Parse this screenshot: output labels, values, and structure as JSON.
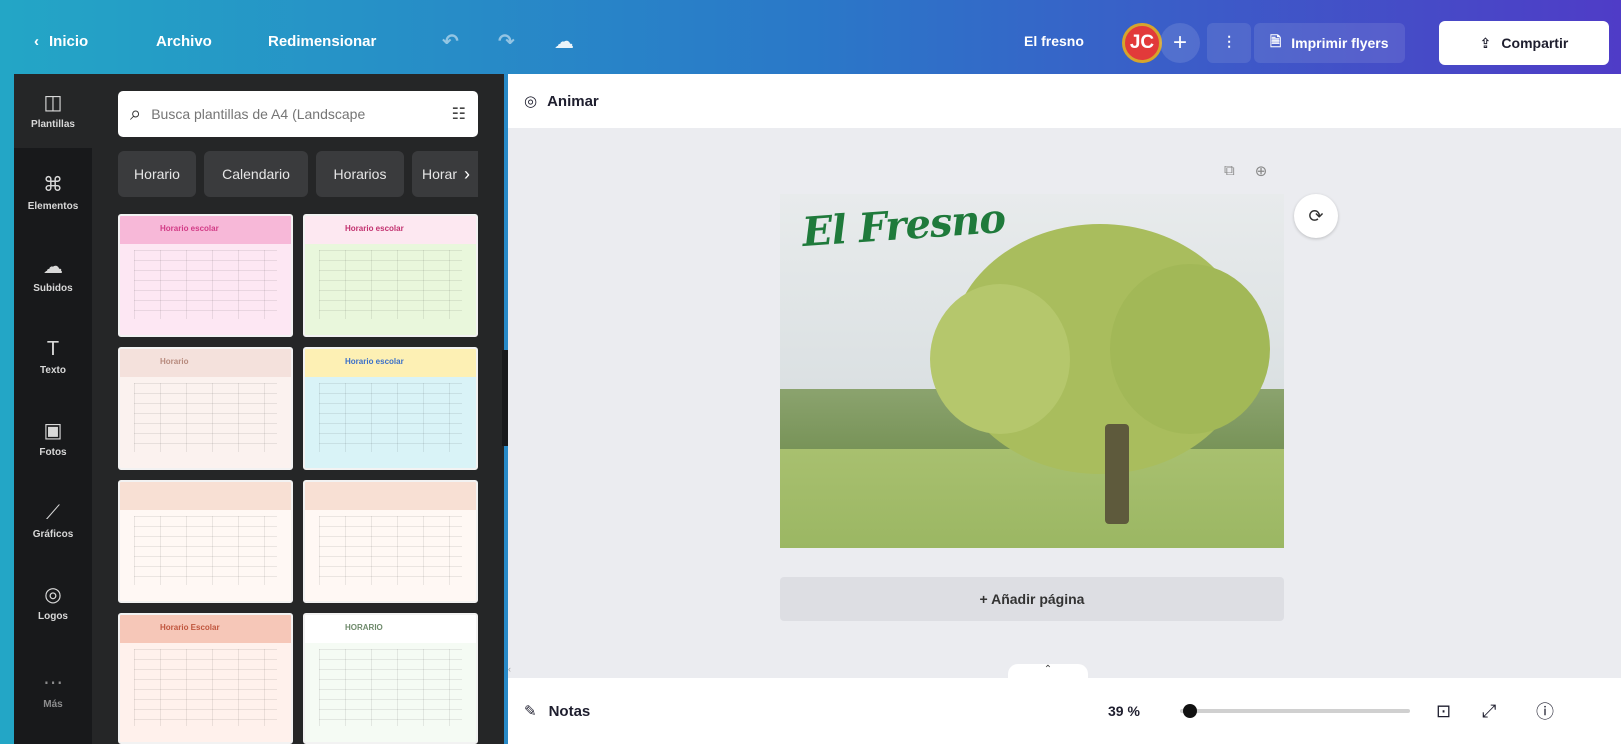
{
  "topbar": {
    "home_label": "Inicio",
    "file_label": "Archivo",
    "resize_label": "Redimensionar",
    "doc_name": "El fresno",
    "avatar_initials": "JC",
    "print_label": "Imprimir flyers",
    "share_label": "Compartir"
  },
  "icons": {
    "back": "‹",
    "undo": "↶",
    "redo": "↷",
    "cloud": "☁",
    "plus": "+",
    "chart": "⫶",
    "print": "🗎",
    "share": "⇪"
  },
  "rail": {
    "items": [
      {
        "label": "Plantillas",
        "icon": "◫"
      },
      {
        "label": "Elementos",
        "icon": "⌘"
      },
      {
        "label": "Subidos",
        "icon": "☁"
      },
      {
        "label": "Texto",
        "icon": "T"
      },
      {
        "label": "Fotos",
        "icon": "▣"
      },
      {
        "label": "Gráficos",
        "icon": "⟋"
      },
      {
        "label": "Logos",
        "icon": "◎"
      },
      {
        "label": "Más",
        "icon": "⋯"
      }
    ]
  },
  "panel": {
    "search_placeholder": "Busca plantillas de A4 (Landscape",
    "chips": [
      "Horario",
      "Calendario",
      "Horarios",
      "Horar"
    ],
    "templates": [
      {
        "title": "Horario escolar",
        "bg": "#fde7f3",
        "header": "#f7b8d8",
        "title_color": "#d23b86"
      },
      {
        "title": "Horario escolar",
        "bg": "#e9f7dc",
        "header": "#fde8f1",
        "title_color": "#c2316f"
      },
      {
        "title": "Horario",
        "bg": "#fbf2ef",
        "header": "#f4e1dc",
        "title_color": "#b78a7d"
      },
      {
        "title": "Horario escolar",
        "bg": "#d9f3f7",
        "header": "#fdf0b4",
        "title_color": "#3a6fc9"
      },
      {
        "title": "",
        "bg": "#fff8f4",
        "header": "#f8e0d4",
        "title_color": "#c99884"
      },
      {
        "title": "",
        "bg": "#fff8f4",
        "header": "#f8e0d4",
        "title_color": "#c99884"
      },
      {
        "title": "Horario Escolar",
        "bg": "#fff1ec",
        "header": "#f6c7b8",
        "title_color": "#c0563e"
      },
      {
        "title": "HORARIO",
        "bg": "#f5fbf4",
        "header": "#ffffff",
        "title_color": "#6e8a6b"
      }
    ]
  },
  "editor": {
    "animate_label": "Animar",
    "page_wordmark": "El Fresno",
    "add_page_label": "+ Añadir página",
    "notes_label": "Notas",
    "zoom_label": "39 %",
    "zoom_level": 0.02
  }
}
